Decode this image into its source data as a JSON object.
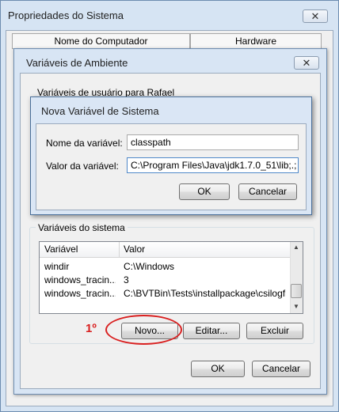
{
  "system_properties": {
    "title": "Propriedades do Sistema",
    "close_label": "✕",
    "tabs": [
      "Nome do Computador",
      "Hardware"
    ]
  },
  "env_vars_dialog": {
    "title": "Variáveis de Ambiente",
    "close_label": "✕",
    "user_vars_label": "Variáveis de usuário para Rafael",
    "system_vars_label": "Variáveis do sistema",
    "columns": [
      "Variável",
      "Valor"
    ],
    "rows": [
      {
        "name": "windir",
        "value": "C:\\Windows"
      },
      {
        "name": "windows_tracin...",
        "value": "3"
      },
      {
        "name": "windows_tracin...",
        "value": "C:\\BVTBin\\Tests\\installpackage\\csilogfile..."
      }
    ],
    "buttons": {
      "novo": "Novo...",
      "editar": "Editar...",
      "excluir": "Excluir",
      "ok": "OK",
      "cancel": "Cancelar"
    },
    "annotation": "1º",
    "annotation_color": "#d92020"
  },
  "new_var_dialog": {
    "title": "Nova Variável de Sistema",
    "name_label": "Nome da variável:",
    "name_value": "classpath",
    "value_label": "Valor da variável:",
    "value_value": "C:\\Program Files\\Java\\jdk1.7.0_51\\lib;.;",
    "ok": "OK",
    "cancel": "Cancelar"
  },
  "icons": {
    "scroll_up": "▲",
    "scroll_down": "▼"
  }
}
